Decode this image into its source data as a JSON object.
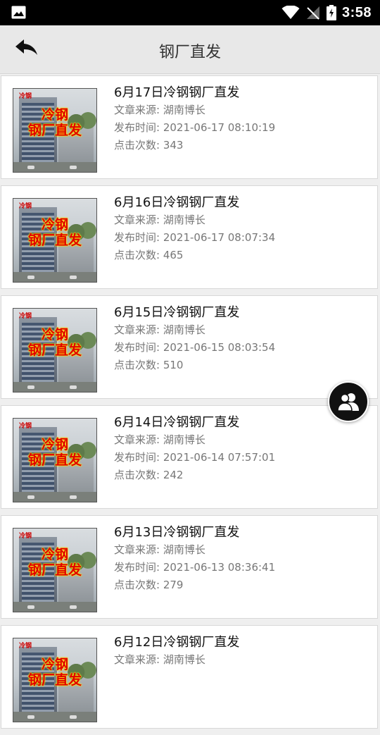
{
  "status_bar": {
    "time": "3:58"
  },
  "header": {
    "title": "钢厂直发",
    "back_icon": "back-arrow-icon"
  },
  "thumbnail": {
    "logo_text": "冷钢",
    "overlay_line1": "冷钢",
    "overlay_line2": "钢厂直发"
  },
  "articles": [
    {
      "title": "6月17日冷钢钢厂直发",
      "source": "文章来源: 湖南博长",
      "time": "发布时间: 2021-06-17 08:10:19",
      "views": "点击次数: 343"
    },
    {
      "title": "6月16日冷钢钢厂直发",
      "source": "文章来源: 湖南博长",
      "time": "发布时间: 2021-06-17 08:07:34",
      "views": "点击次数: 465"
    },
    {
      "title": "6月15日冷钢钢厂直发",
      "source": "文章来源: 湖南博长",
      "time": "发布时间: 2021-06-15 08:03:54",
      "views": "点击次数: 510"
    },
    {
      "title": "6月14日冷钢钢厂直发",
      "source": "文章来源: 湖南博长",
      "time": "发布时间: 2021-06-14 07:57:01",
      "views": "点击次数: 242"
    },
    {
      "title": "6月13日冷钢钢厂直发",
      "source": "文章来源: 湖南博长",
      "time": "发布时间: 2021-06-13 08:36:41",
      "views": "点击次数: 279"
    },
    {
      "title": "6月12日冷钢钢厂直发",
      "source": "文章来源: 湖南博长",
      "time": "",
      "views": ""
    }
  ],
  "fab": {
    "icon": "contacts-icon"
  },
  "colors": {
    "status_bar": "#000000",
    "toolbar": "#e8e8e8",
    "background": "#efefef",
    "overlay_text": "#e00000"
  }
}
